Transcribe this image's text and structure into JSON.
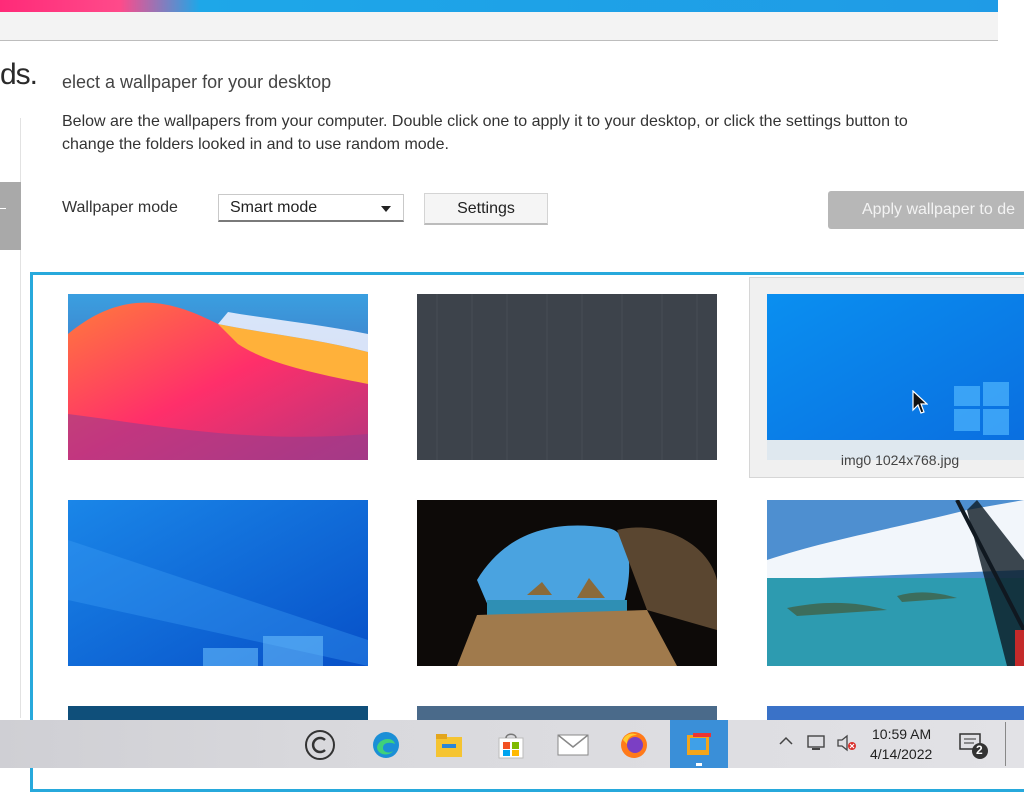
{
  "window": {
    "brand_fragment": "ds.",
    "page_title": "elect a wallpaper for your desktop",
    "description": "Below are the wallpapers from your computer.  Double click one to apply it to your desktop, or click the settings button to change the folders looked in and to use random mode."
  },
  "controls": {
    "mode_label": "Wallpaper mode",
    "mode_selected": "Smart mode",
    "settings_label": "Settings",
    "apply_label": "Apply wallpaper to de"
  },
  "wallpapers": {
    "selected_caption": "img0 1024x768.jpg",
    "items": [
      "macos-big-sur-gradient",
      "dark-grey-texture",
      "windows-10-blue-selected",
      "windows-10-light-blue",
      "rock-arch-beach",
      "ocean-islands-aerial"
    ]
  },
  "taskbar": {
    "time": "10:59 AM",
    "date": "4/14/2022",
    "notification_count": "2",
    "icons": [
      "copyright-icon",
      "edge-icon",
      "file-explorer-icon",
      "store-icon",
      "mail-icon",
      "firefox-icon",
      "wallpaper-app-icon"
    ]
  },
  "colors": {
    "accent": "#27a9dc",
    "apply_disabled": "#b7b7b7",
    "taskbar_active": "#3a8fd8"
  }
}
